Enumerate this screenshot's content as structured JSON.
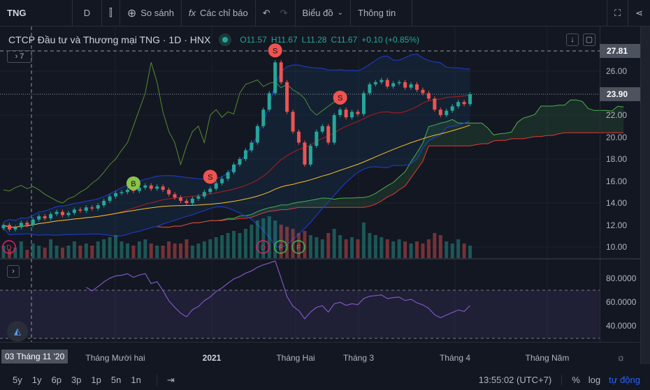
{
  "toolbar": {
    "symbol": "TNG",
    "interval": "D",
    "compare": "So sánh",
    "indicators": "Các chỉ báo",
    "chart_type": "Biểu đồ",
    "info": "Thông tin"
  },
  "legend": {
    "title": "CTCP Đầu tư và Thương mại TNG · 1D · HNX",
    "open": "O11.57",
    "high": "H11.67",
    "low": "L11.28",
    "close": "C11.67",
    "change": "+0.10 (+0.85%)",
    "collapse": "7"
  },
  "price_axis": {
    "labels": [
      "26.00",
      "24.00",
      "22.00",
      "20.00",
      "18.00",
      "16.00",
      "14.00",
      "12.00",
      "10.00"
    ],
    "high_tag": "27.81",
    "last_tag": "23.90"
  },
  "rsi_axis": {
    "labels": [
      "80.0000",
      "60.0000",
      "40.0000"
    ]
  },
  "time_axis": {
    "cursor": "03 Tháng 11 '20",
    "labels": [
      "Tháng Mười hai",
      "2021",
      "Tháng Hai",
      "Tháng 3",
      "Tháng 4",
      "Tháng Năm"
    ]
  },
  "bottom": {
    "ranges": [
      "5y",
      "1y",
      "6p",
      "3p",
      "1p",
      "5n",
      "1n"
    ],
    "clock": "13:55:02 (UTC+7)",
    "percent": "%",
    "log": "log",
    "auto": "tự động"
  },
  "colors": {
    "up": "#26a69a",
    "down": "#ef5350",
    "accent": "#2962ff",
    "bg": "#131722"
  },
  "chart_data": {
    "type": "candlestick",
    "ylim": [
      9,
      28.5
    ],
    "closes": [
      12.0,
      11.6,
      11.8,
      12.2,
      12.0,
      12.5,
      12.8,
      12.6,
      13.0,
      13.2,
      12.9,
      13.1,
      13.4,
      13.3,
      13.6,
      13.5,
      13.8,
      14.2,
      14.6,
      14.9,
      15.0,
      15.2,
      15.1,
      15.4,
      15.6,
      15.3,
      15.5,
      15.2,
      14.8,
      14.5,
      14.2,
      14.0,
      14.4,
      14.6,
      15.0,
      15.3,
      15.8,
      16.2,
      16.8,
      17.5,
      18.0,
      18.8,
      19.5,
      21.0,
      22.5,
      24.0,
      26.8,
      25.0,
      22.3,
      20.5,
      19.5,
      17.5,
      19.2,
      20.5,
      21.0,
      19.5,
      22.0,
      22.5,
      21.8,
      22.3,
      22.1,
      24.0,
      24.8,
      25.0,
      25.2,
      24.6,
      24.9,
      25.0,
      24.5,
      24.8,
      24.3,
      24.0,
      23.5,
      22.5,
      22.0,
      22.4,
      22.8,
      23.2,
      23.0,
      23.9
    ],
    "volumes": [
      30,
      20,
      25,
      40,
      20,
      35,
      30,
      25,
      45,
      30,
      25,
      30,
      40,
      30,
      35,
      30,
      40,
      45,
      50,
      55,
      40,
      35,
      30,
      40,
      45,
      35,
      30,
      30,
      40,
      35,
      35,
      45,
      30,
      35,
      40,
      45,
      50,
      55,
      60,
      65,
      60,
      70,
      80,
      90,
      95,
      100,
      90,
      80,
      75,
      70,
      60,
      65,
      55,
      50,
      45,
      60,
      70,
      55,
      45,
      50,
      45,
      85,
      60,
      55,
      50,
      45,
      40,
      45,
      40,
      35,
      40,
      35,
      45,
      60,
      55,
      40,
      35,
      45,
      35,
      30
    ],
    "signals": [
      {
        "i": 22,
        "label": "B",
        "color": "#8bc34a"
      },
      {
        "i": 35,
        "label": "S",
        "color": "#ef5350"
      },
      {
        "i": 46,
        "label": "S",
        "color": "#ef5350"
      },
      {
        "i": 57,
        "label": "S",
        "color": "#ef5350"
      }
    ],
    "events": [
      {
        "i": 0,
        "label": "D",
        "color": "#e91e63"
      },
      {
        "i": 43,
        "label": "D",
        "color": "#e91e63"
      },
      {
        "i": 46,
        "label": "F",
        "color": "#4caf50"
      },
      {
        "i": 49,
        "label": "F",
        "color": "#4caf50"
      }
    ],
    "rsi_levels": [
      70,
      30
    ]
  }
}
